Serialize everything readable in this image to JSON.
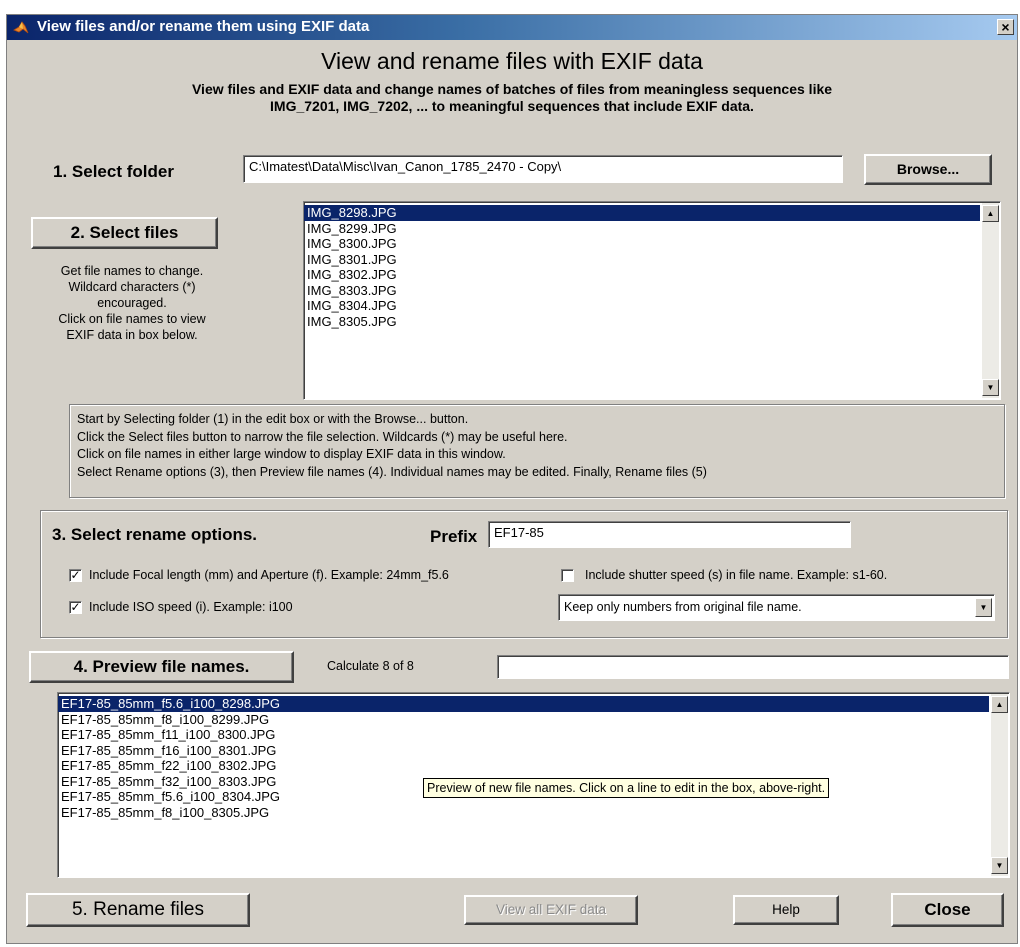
{
  "window": {
    "title": "View files and/or rename them using EXIF data",
    "close_glyph": "×",
    "icon": "matlab-icon"
  },
  "header": {
    "title": "View and rename files with EXIF data",
    "subtitle_line1": "View files and EXIF data and change names of batches of files from meaningless sequences like",
    "subtitle_line2": "IMG_7201, IMG_7202, ... to meaningful sequences that include EXIF data."
  },
  "step1": {
    "label": "1. Select folder",
    "folder_value": "C:\\Imatest\\Data\\Misc\\Ivan_Canon_1785_2470 - Copy\\",
    "browse_label": "Browse..."
  },
  "step2": {
    "button_label": "2. Select files",
    "help_lines": [
      "Get file names to change.",
      "Wildcard characters (*)",
      "encouraged.",
      "Click on file names to view",
      "EXIF data in box below."
    ],
    "files": [
      "IMG_8298.JPG",
      "IMG_8299.JPG",
      "IMG_8300.JPG",
      "IMG_8301.JPG",
      "IMG_8302.JPG",
      "IMG_8303.JPG",
      "IMG_8304.JPG",
      "IMG_8305.JPG"
    ],
    "selected_index": 0
  },
  "instructions": [
    "Start by Selecting folder (1) in the edit box or with the Browse... button.",
    "Click the Select files button to narrow the file selection. Wildcards (*) may be useful here.",
    "Click on file names in either large window to display EXIF data in this window.",
    "Select Rename options (3), then Preview file names (4). Individual names may be edited. Finally, Rename files (5)"
  ],
  "step3": {
    "label": "3. Select rename options.",
    "prefix_label": "Prefix",
    "prefix_value": "EF17-85",
    "focal_checkbox": {
      "label": "Include Focal length (mm) and Aperture (f). Example: 24mm_f5.6",
      "checked": true
    },
    "iso_checkbox": {
      "label": "Include ISO speed (i). Example: i100",
      "checked": true
    },
    "shutter_checkbox": {
      "label": "Include shutter speed (s) in file name. Example: s1-60.",
      "checked": false
    },
    "numbers_select": {
      "value": "Keep only numbers from original file name."
    }
  },
  "step4": {
    "button_label": "4. Preview file names.",
    "calc_status": "Calculate 8 of 8",
    "edit_value": "",
    "preview_names": [
      "EF17-85_85mm_f5.6_i100_8298.JPG",
      "EF17-85_85mm_f8_i100_8299.JPG",
      "EF17-85_85mm_f11_i100_8300.JPG",
      "EF17-85_85mm_f16_i100_8301.JPG",
      "EF17-85_85mm_f22_i100_8302.JPG",
      "EF17-85_85mm_f32_i100_8303.JPG",
      "EF17-85_85mm_f5.6_i100_8304.JPG",
      "EF17-85_85mm_f8_i100_8305.JPG"
    ],
    "selected_index": 0,
    "tooltip": "Preview of new file names. Click on a line to edit in the box, above-right."
  },
  "footer": {
    "rename_label": "5. Rename files",
    "view_exif_label": "View all EXIF data",
    "help_label": "Help",
    "close_label": "Close"
  },
  "colors": {
    "window_bg": "#d4d0c8",
    "selection": "#0a246a",
    "title_gradient_start": "#0a246a",
    "title_gradient_end": "#a6caf0",
    "tooltip_bg": "#ffffe1"
  }
}
